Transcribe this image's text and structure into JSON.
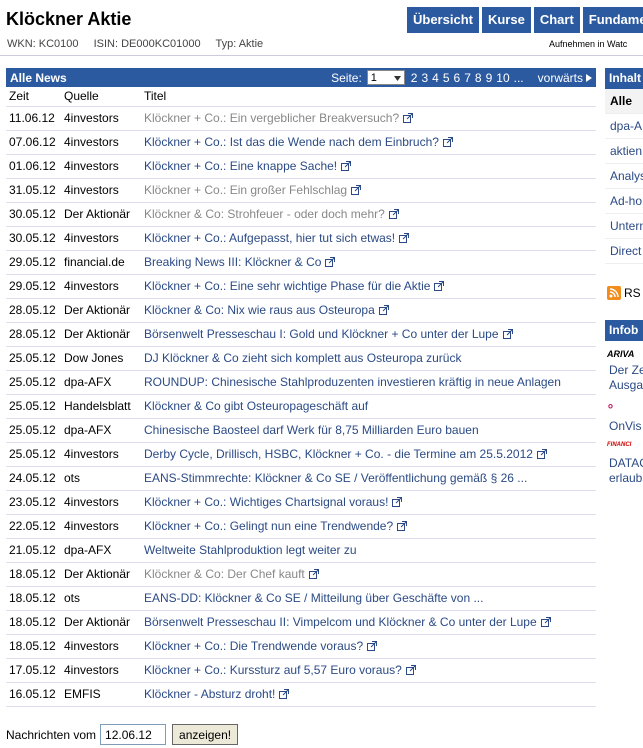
{
  "header": {
    "title": "Klöckner Aktie",
    "wkn": "WKN: KC0100",
    "isin": "ISIN: DE000KC01000",
    "typ": "Typ: Aktie",
    "nav": [
      "Übersicht",
      "Kurse",
      "Chart",
      "Fundamen"
    ],
    "watch": "Aufnehmen in Watc"
  },
  "news": {
    "heading": "Alle News",
    "pager_label": "Seite:",
    "page_selected": "1",
    "pages": [
      "2",
      "3",
      "4",
      "5",
      "6",
      "7",
      "8",
      "9",
      "10",
      "..."
    ],
    "next_label": "vorwärts",
    "columns": [
      "Zeit",
      "Quelle",
      "Titel"
    ],
    "rows": [
      {
        "date": "11.06.12",
        "source": "4investors",
        "title": "Klöckner + Co.: Ein vergeblicher Breakversuch?",
        "ext": true,
        "visited": true
      },
      {
        "date": "07.06.12",
        "source": "4investors",
        "title": "Klöckner + Co.: Ist das die Wende nach dem Einbruch?",
        "ext": true,
        "visited": false
      },
      {
        "date": "01.06.12",
        "source": "4investors",
        "title": "Klöckner + Co.: Eine knappe Sache!",
        "ext": true,
        "visited": false
      },
      {
        "date": "31.05.12",
        "source": "4investors",
        "title": "Klöckner + Co.: Ein großer Fehlschlag",
        "ext": true,
        "visited": true
      },
      {
        "date": "30.05.12",
        "source": "Der Aktionär",
        "title": "Klöckner & Co: Strohfeuer - oder doch mehr?",
        "ext": true,
        "visited": true
      },
      {
        "date": "30.05.12",
        "source": "4investors",
        "title": "Klöckner + Co.: Aufgepasst, hier tut sich etwas!",
        "ext": true,
        "visited": false
      },
      {
        "date": "29.05.12",
        "source": "financial.de",
        "title": "Breaking News III: Klöckner & Co",
        "ext": true,
        "visited": false
      },
      {
        "date": "29.05.12",
        "source": "4investors",
        "title": "Klöckner + Co.: Eine sehr wichtige Phase für die Aktie",
        "ext": true,
        "visited": false
      },
      {
        "date": "28.05.12",
        "source": "Der Aktionär",
        "title": "Klöckner & Co: Nix wie raus aus Osteuropa",
        "ext": true,
        "visited": false
      },
      {
        "date": "28.05.12",
        "source": "Der Aktionär",
        "title": "Börsenwelt Presseschau I: Gold und Klöckner + Co unter der Lupe",
        "ext": true,
        "visited": false
      },
      {
        "date": "25.05.12",
        "source": "Dow Jones",
        "title": "DJ Klöckner & Co zieht sich komplett aus Osteuropa zurück",
        "ext": false,
        "visited": false
      },
      {
        "date": "25.05.12",
        "source": "dpa-AFX",
        "title": "ROUNDUP: Chinesische Stahlproduzenten investieren kräftig in neue Anlagen",
        "ext": false,
        "visited": false
      },
      {
        "date": "25.05.12",
        "source": "Handelsblatt",
        "title": "Klöckner & Co gibt Osteuropageschäft auf",
        "ext": false,
        "visited": false
      },
      {
        "date": "25.05.12",
        "source": "dpa-AFX",
        "title": "Chinesische Baosteel darf Werk für 8,75 Milliarden Euro bauen",
        "ext": false,
        "visited": false
      },
      {
        "date": "25.05.12",
        "source": "4investors",
        "title": "Derby Cycle, Drillisch, HSBC, Klöckner + Co. - die Termine am 25.5.2012",
        "ext": true,
        "visited": false
      },
      {
        "date": "24.05.12",
        "source": "ots",
        "title": "EANS-Stimmrechte: Klöckner & Co SE / Veröffentlichung gemäß § 26 ...",
        "ext": false,
        "visited": false
      },
      {
        "date": "23.05.12",
        "source": "4investors",
        "title": "Klöckner + Co.: Wichtiges Chartsignal voraus!",
        "ext": true,
        "visited": false
      },
      {
        "date": "22.05.12",
        "source": "4investors",
        "title": "Klöckner + Co.: Gelingt nun eine Trendwende?",
        "ext": true,
        "visited": false
      },
      {
        "date": "21.05.12",
        "source": "dpa-AFX",
        "title": "Weltweite Stahlproduktion legt weiter zu",
        "ext": false,
        "visited": false
      },
      {
        "date": "18.05.12",
        "source": "Der Aktionär",
        "title": "Klöckner & Co: Der Chef kauft",
        "ext": true,
        "visited": true
      },
      {
        "date": "18.05.12",
        "source": "ots",
        "title": "EANS-DD: Klöckner & Co SE / Mitteilung über Geschäfte von ...",
        "ext": false,
        "visited": false
      },
      {
        "date": "18.05.12",
        "source": "Der Aktionär",
        "title": "Börsenwelt Presseschau II: Vimpelcom und Klöckner & Co unter der Lupe",
        "ext": true,
        "visited": false
      },
      {
        "date": "18.05.12",
        "source": "4investors",
        "title": "Klöckner + Co.: Die Trendwende voraus?",
        "ext": true,
        "visited": false
      },
      {
        "date": "17.05.12",
        "source": "4investors",
        "title": "Klöckner + Co.: Kurssturz auf 5,57 Euro voraus?",
        "ext": true,
        "visited": false
      },
      {
        "date": "16.05.12",
        "source": "EMFIS",
        "title": "Klöckner - Absturz droht!",
        "ext": true,
        "visited": false
      }
    ]
  },
  "footer": {
    "label": "Nachrichten vom",
    "date_value": "12.06.12",
    "button": "anzeigen!"
  },
  "sidebar": {
    "heading": "Inhalt",
    "items": [
      "Alle",
      "dpa-A",
      "aktien",
      "Analys",
      "Ad-ho",
      "Untern",
      "Direct"
    ],
    "rss": "RS",
    "heading2": "Infob",
    "logo1": "ARIVA",
    "text1a": "Der Ze",
    "text1b": "Ausga",
    "logo2": "°",
    "text2": "OnVis",
    "logo3": "FINANCI",
    "text3a": "DATAC",
    "text3b": "erlaub"
  },
  "colors": {
    "accent": "#2c5aa0",
    "link": "#2b4a86",
    "visited": "#888888"
  }
}
